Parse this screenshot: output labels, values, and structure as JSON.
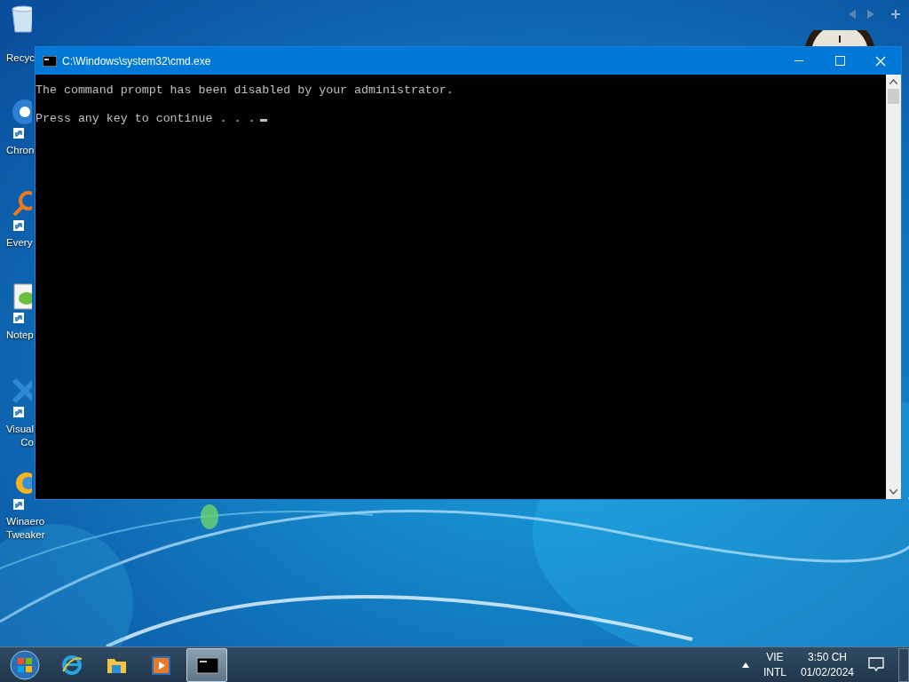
{
  "desktop_icons": [
    {
      "kind": "recycle",
      "label_lines": [
        "Recyc"
      ]
    },
    {
      "kind": "chrome",
      "label_lines": [
        "Chron"
      ]
    },
    {
      "kind": "search",
      "label_lines": [
        "Every"
      ]
    },
    {
      "kind": "notepad",
      "label_lines": [
        "Notep"
      ]
    },
    {
      "kind": "vscode",
      "label_lines": [
        "Visual",
        "Co"
      ]
    },
    {
      "kind": "winaero",
      "label_lines": [
        "Winaero",
        "Tweaker"
      ]
    }
  ],
  "window": {
    "title": "C:\\Windows\\system32\\cmd.exe",
    "console_lines": [
      "The command prompt has been disabled by your administrator.",
      "Press any key to continue . . ."
    ]
  },
  "taskbar": {
    "pinned": [
      {
        "kind": "ie",
        "active": false
      },
      {
        "kind": "folder",
        "active": false
      },
      {
        "kind": "media",
        "active": false
      },
      {
        "kind": "cmd",
        "active": true
      }
    ],
    "language": {
      "top": "VIE",
      "bottom": "INTL"
    },
    "clock": {
      "time": "3:50 CH",
      "date": "01/02/2024"
    }
  }
}
